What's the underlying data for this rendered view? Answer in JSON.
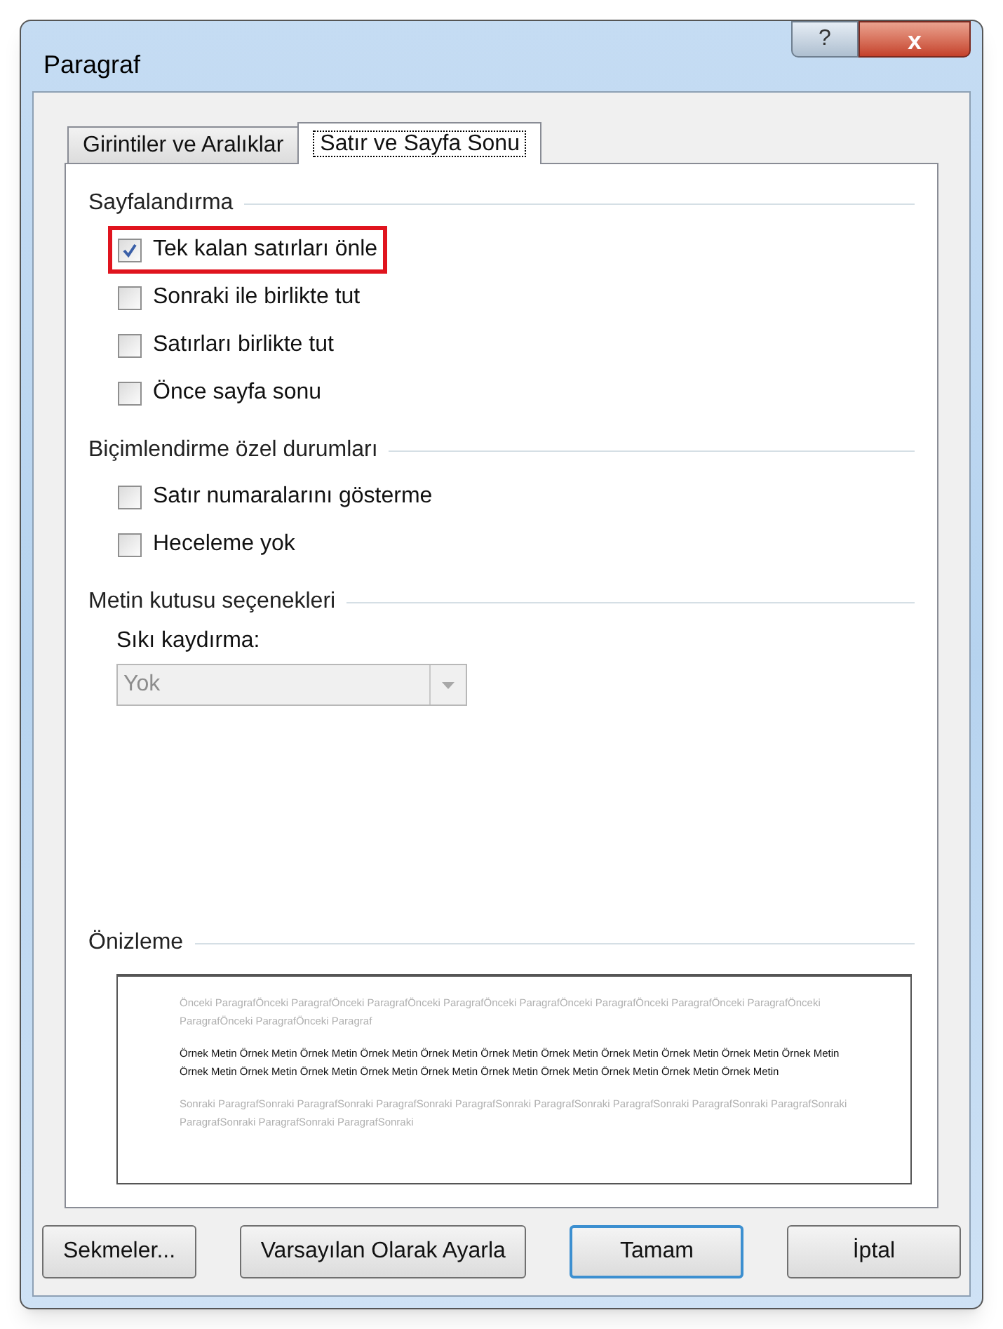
{
  "window": {
    "title": "Paragraf",
    "help_button": "?",
    "close_button": "x"
  },
  "tabs": [
    {
      "label": "Girintiler ve Aralıklar",
      "selected": false
    },
    {
      "label": "Satır ve Sayfa Sonu",
      "selected": true
    }
  ],
  "sections": [
    {
      "title": "Sayfalandırma",
      "options": [
        {
          "label": "Tek kalan satırları önle",
          "checked": true,
          "highlighted": true
        },
        {
          "label": "Sonraki ile birlikte tut",
          "checked": false,
          "highlighted": false
        },
        {
          "label": "Satırları birlikte tut",
          "checked": false,
          "highlighted": false
        },
        {
          "label": "Önce sayfa sonu",
          "checked": false,
          "highlighted": false
        }
      ]
    },
    {
      "title": "Biçimlendirme özel durumları",
      "options": [
        {
          "label": "Satır numaralarını gösterme",
          "checked": false,
          "highlighted": false
        },
        {
          "label": "Heceleme yok",
          "checked": false,
          "highlighted": false
        }
      ]
    },
    {
      "title": "Metin kutusu seçenekleri",
      "dropdown": {
        "label": "Sıkı kaydırma:",
        "value": "Yok",
        "disabled": true
      }
    }
  ],
  "preview": {
    "title": "Önizleme",
    "paragraphs": [
      {
        "kind": "before",
        "text": "Önceki ParagrafÖnceki ParagrafÖnceki ParagrafÖnceki ParagrafÖnceki ParagrafÖnceki ParagrafÖnceki ParagrafÖnceki ParagrafÖnceki ParagrafÖnceki ParagrafÖnceki Paragraf"
      },
      {
        "kind": "sample",
        "text": "Örnek Metin Örnek Metin Örnek Metin Örnek Metin Örnek Metin Örnek Metin Örnek Metin Örnek Metin Örnek Metin Örnek Metin Örnek Metin Örnek Metin Örnek Metin Örnek Metin Örnek Metin Örnek Metin Örnek Metin Örnek Metin Örnek Metin Örnek Metin Örnek Metin"
      },
      {
        "kind": "after",
        "text": "Sonraki ParagrafSonraki ParagrafSonraki ParagrafSonraki ParagrafSonraki ParagrafSonraki ParagrafSonraki ParagrafSonraki ParagrafSonraki ParagrafSonraki ParagrafSonraki ParagrafSonraki"
      }
    ]
  },
  "buttons": [
    {
      "label": "Sekmeler...",
      "default": false
    },
    {
      "label": "Varsayılan Olarak Ayarla",
      "default": false
    },
    {
      "label": "Tamam",
      "default": true
    },
    {
      "label": "İptal",
      "default": false
    }
  ]
}
